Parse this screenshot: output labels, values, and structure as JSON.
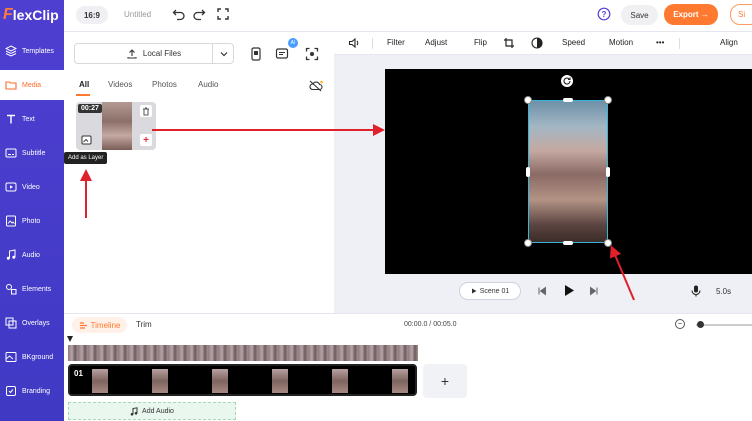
{
  "app": {
    "logo_first": "F",
    "logo_rest": "lexClip"
  },
  "sidebar": {
    "items": [
      {
        "label": "Templates",
        "icon": "layers-icon"
      },
      {
        "label": "Media",
        "icon": "folder-icon",
        "active": true
      },
      {
        "label": "Text",
        "icon": "text-icon"
      },
      {
        "label": "Subtitle",
        "icon": "subtitle-icon"
      },
      {
        "label": "Video",
        "icon": "video-icon"
      },
      {
        "label": "Photo",
        "icon": "photo-icon"
      },
      {
        "label": "Audio",
        "icon": "music-icon"
      },
      {
        "label": "Elements",
        "icon": "elements-icon"
      },
      {
        "label": "Overlays",
        "icon": "overlays-icon"
      },
      {
        "label": "BKground",
        "icon": "background-icon"
      },
      {
        "label": "Branding",
        "icon": "branding-icon"
      }
    ]
  },
  "topbar": {
    "ratio": "16:9",
    "title": "Untitled",
    "save": "Save",
    "export": "Export →",
    "signin": "Si"
  },
  "media_panel": {
    "local_files": "Local Files",
    "ai_badge": "AI",
    "tabs": [
      "All",
      "Videos",
      "Photos",
      "Audio"
    ],
    "thumb_duration": "00:27",
    "add_symbol": "+",
    "tooltip": "Add as Layer"
  },
  "edit_toolbar": {
    "filter": "Filter",
    "adjust": "Adjust",
    "flip": "Flip",
    "speed": "Speed",
    "motion": "Motion",
    "more": "•••",
    "align": "Align"
  },
  "player": {
    "scene": "Scene 01",
    "duration": "5.0s"
  },
  "timeline": {
    "timeline_tab": "Timeline",
    "trim_tab": "Trim",
    "time": "00:00.0 / 00:05.0",
    "track_number": "01",
    "add_track": "+",
    "add_audio": "Add Audio",
    "zoom_minus": "−"
  },
  "colors": {
    "accent": "#ff7a30",
    "sidebar": "#4f3fd1",
    "annotation": "#e0202a",
    "selection": "#3ab5d8"
  }
}
